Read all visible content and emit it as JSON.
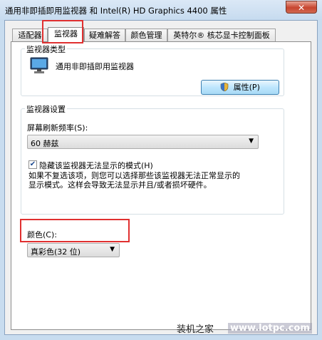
{
  "window": {
    "title": "通用非即插即用监视器 和 Intel(R) HD Graphics 4400 属性",
    "close_label": "✕"
  },
  "tabs": [
    {
      "label": "适配器"
    },
    {
      "label": "监视器"
    },
    {
      "label": "疑难解答"
    },
    {
      "label": "颜色管理"
    },
    {
      "label": "英特尔® 核芯显卡控制面板"
    }
  ],
  "monitor_type": {
    "group_label": "监视器类型",
    "monitor_name": "通用非即插即用监视器",
    "properties_button": "属性(P)"
  },
  "monitor_settings": {
    "group_label": "监视器设置",
    "refresh_label": "屏幕刷新频率(S):",
    "refresh_value": "60 赫兹",
    "hide_modes_checked": true,
    "hide_modes_label": "隐藏该监视器无法显示的模式(H)",
    "description_line1": "如果不复选该项，则您可以选择那些该监视器无法正常显示的",
    "description_line2": "显示模式。这样会导致无法显示并且/或者损坏硬件。"
  },
  "colors": {
    "label": "颜色(C):",
    "value": "真彩色(32 位)"
  },
  "watermark": {
    "site_name": "装机之家",
    "url": "www.lotpc.com"
  }
}
